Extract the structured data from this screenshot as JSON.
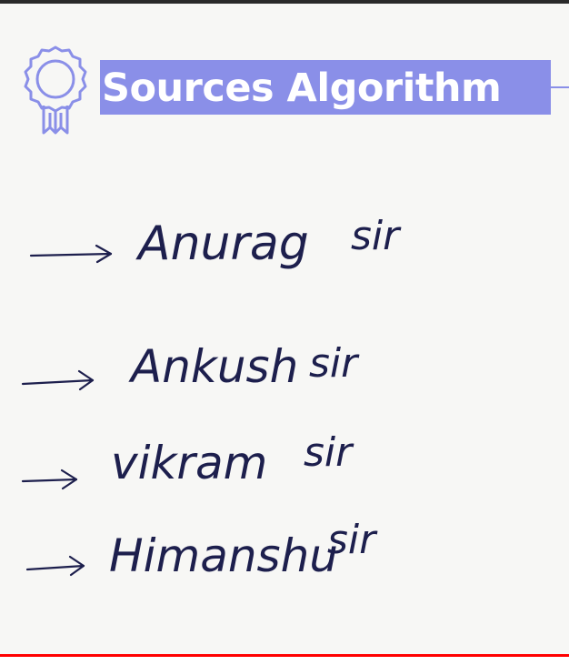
{
  "slide": {
    "title": "Sources Algorithm",
    "badge_icon": "award-ribbon-icon",
    "accent_color": "#8a8fe8"
  },
  "notes": {
    "items": [
      {
        "name": "Anurag",
        "suffix": "sir"
      },
      {
        "name": "Ankush",
        "suffix": "sir"
      },
      {
        "name": "vikram",
        "suffix": "sir"
      },
      {
        "name": "Himanshu",
        "suffix": "sir"
      }
    ],
    "bullet_icon": "arrow-right-icon",
    "ink_color": "#1d1f4d"
  },
  "player": {
    "progress_fraction": 1.0,
    "progress_color": "#ff0000"
  }
}
